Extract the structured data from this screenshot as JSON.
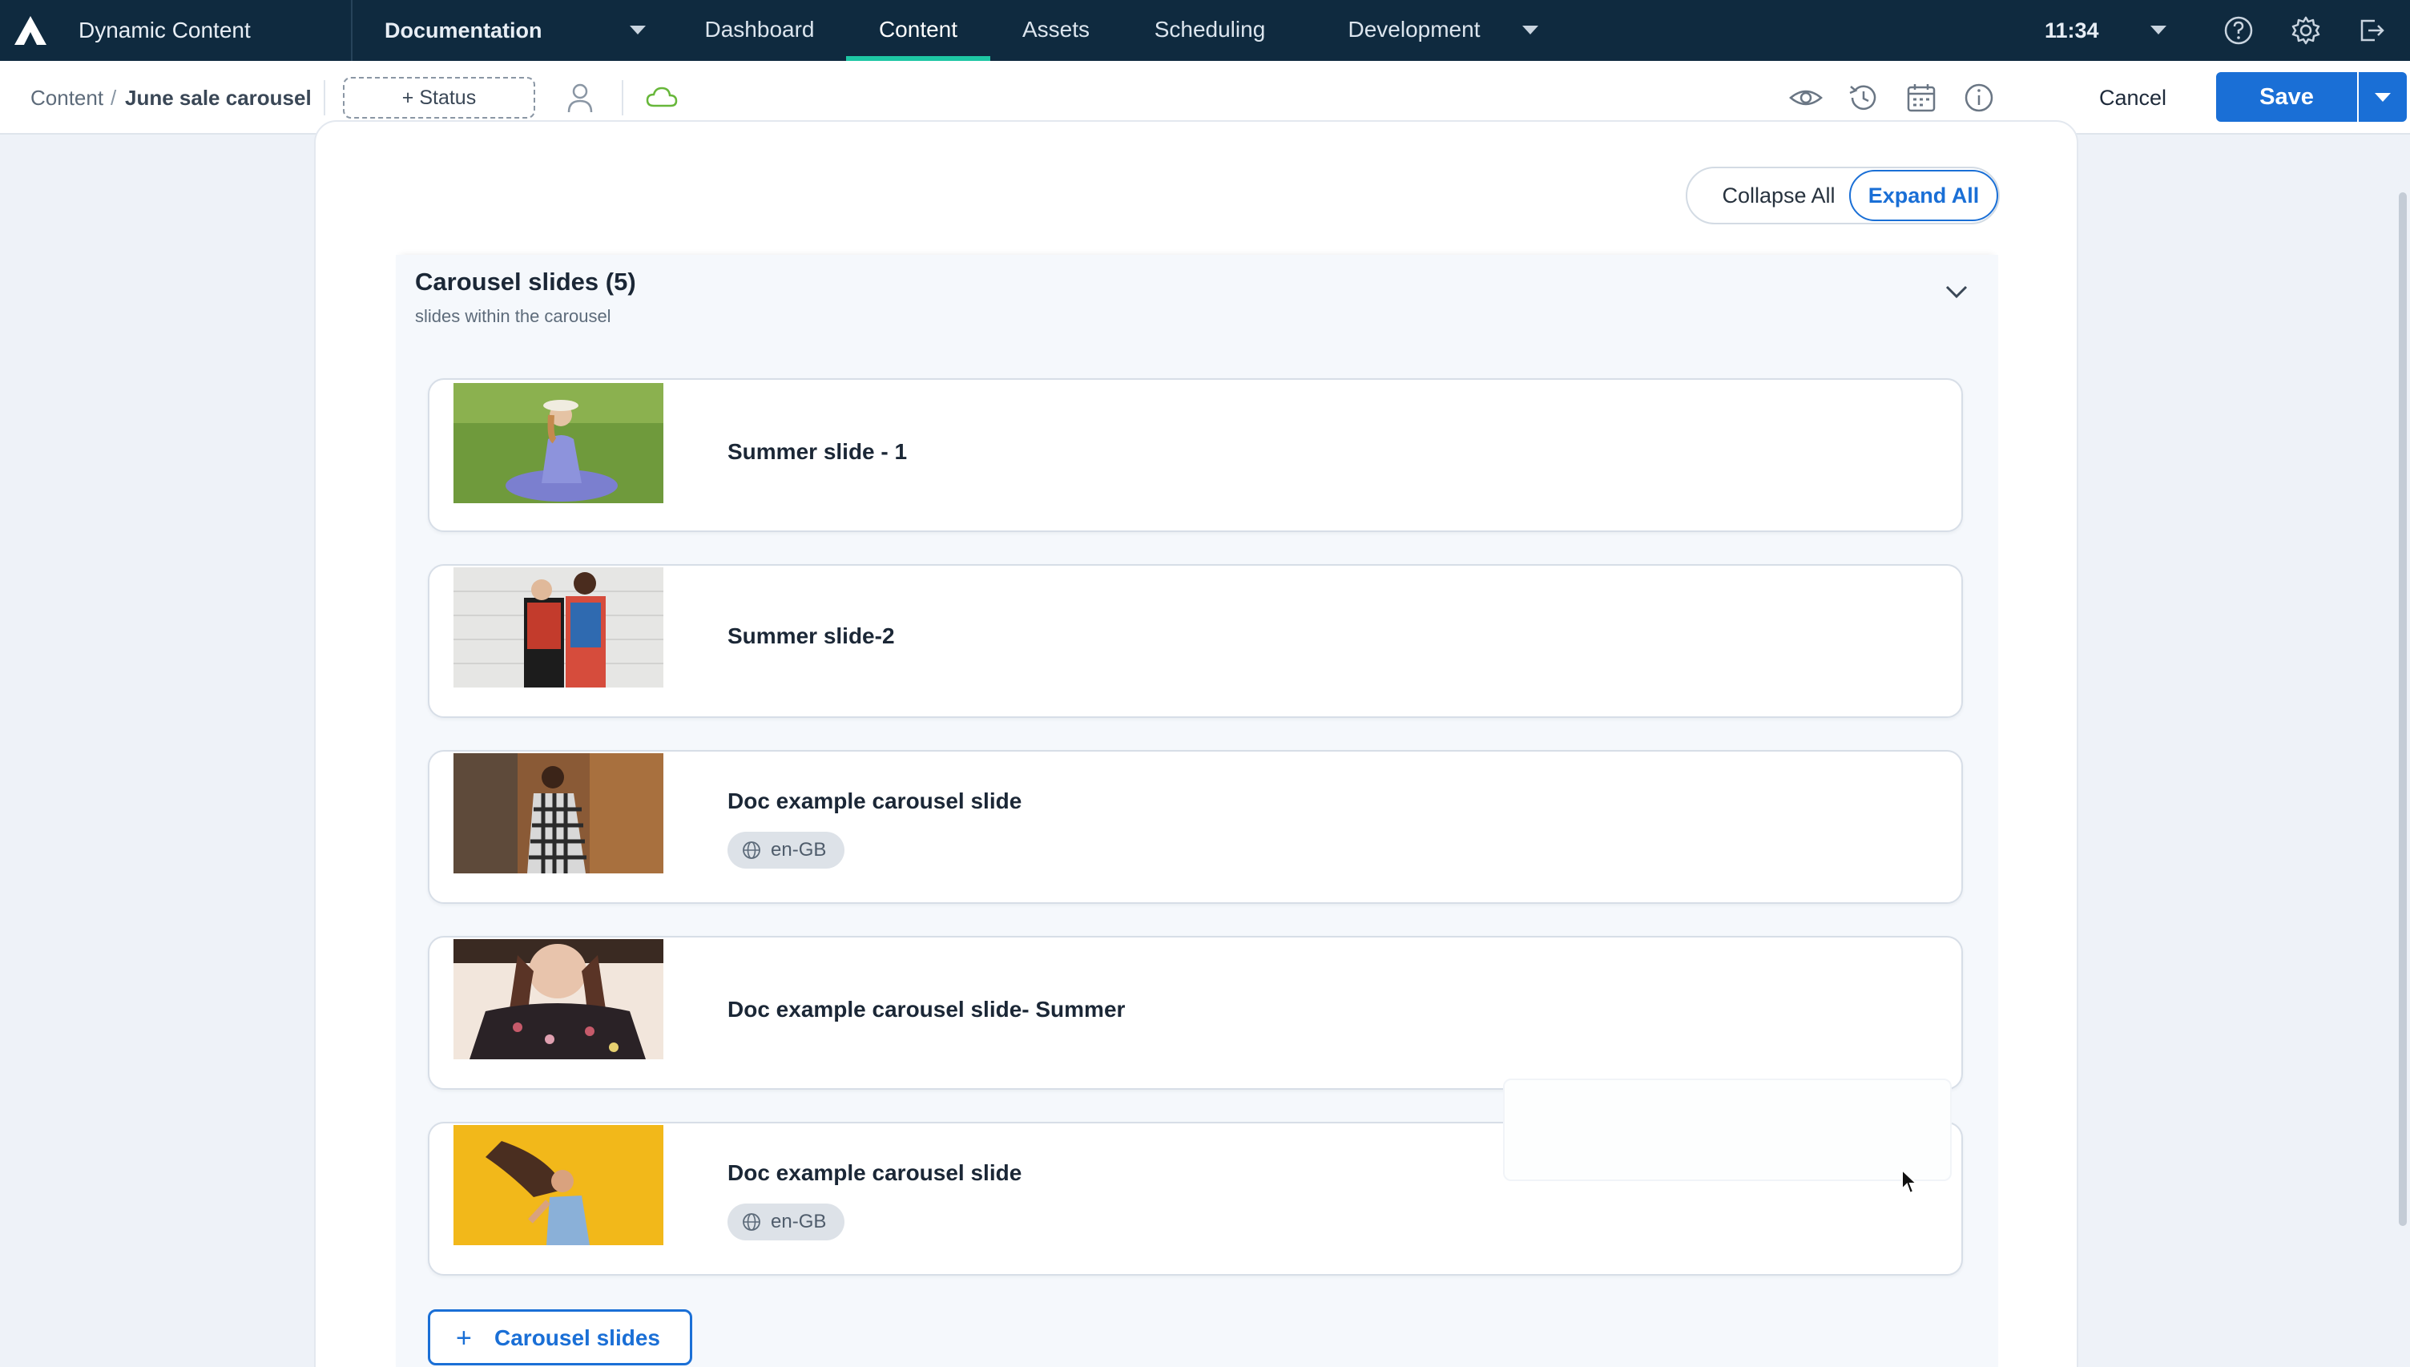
{
  "topnav": {
    "app_name": "Dynamic Content",
    "hub": "Documentation",
    "tabs": [
      {
        "label": "Dashboard",
        "active": false
      },
      {
        "label": "Content",
        "active": true
      },
      {
        "label": "Assets",
        "active": false
      },
      {
        "label": "Scheduling",
        "active": false
      },
      {
        "label": "Development",
        "active": false
      }
    ],
    "time": "11:34",
    "icons": [
      "help-icon",
      "settings-icon",
      "logout-icon"
    ],
    "accent_color": "#1ec7a4",
    "background_color": "#0f2a3f"
  },
  "toolbar": {
    "breadcrumb_root": "Content",
    "breadcrumb_separator": "/",
    "breadcrumb_current": "June sale carousel",
    "status_label": "+ Status",
    "icons": [
      "user-icon",
      "cloud-icon",
      "preview-icon",
      "history-icon",
      "calendar-icon",
      "info-icon"
    ],
    "cancel_label": "Cancel",
    "save_label": "Save",
    "save_color": "#1a6fd6"
  },
  "controls": {
    "collapse_all": "Collapse All",
    "expand_all": "Expand All"
  },
  "section": {
    "title": "Carousel slides (5)",
    "subtitle": "slides within the carousel",
    "add_button_label": "Carousel slides"
  },
  "slides": [
    {
      "title": "Summer slide - 1",
      "locale": null,
      "image": "woman in blue dress sitting on grass"
    },
    {
      "title": "Summer slide-2",
      "locale": null,
      "image": "two people in floral shirts against white wall"
    },
    {
      "title": "Doc example carousel slide",
      "locale": "en-GB",
      "image": "woman in checkered dress by rusty wall"
    },
    {
      "title": "Doc example carousel slide- Summer",
      "locale": null,
      "image": "woman with hat in floral top"
    },
    {
      "title": "Doc example carousel slide",
      "locale": "en-GB",
      "image": "woman with flowing hair on yellow background"
    }
  ]
}
